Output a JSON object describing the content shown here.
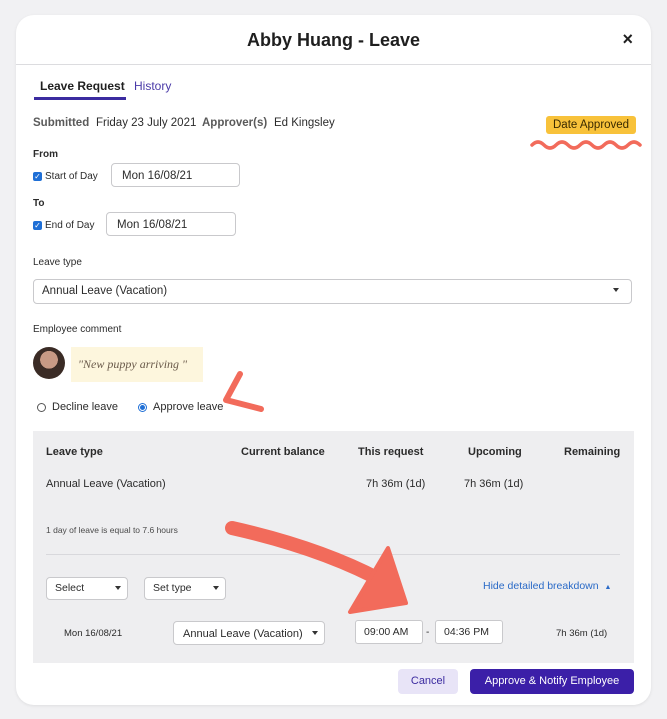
{
  "modal": {
    "title": "Abby Huang - Leave",
    "close_icon": "×"
  },
  "tabs": [
    {
      "label": "Leave Request",
      "active": true
    },
    {
      "label": "History",
      "active": false
    }
  ],
  "meta": {
    "submitted_label": "Submitted",
    "submitted_value": "Friday 23 July 2021",
    "approvers_label": "Approver(s)",
    "approvers_value": "Ed Kingsley",
    "status": "Date Approved",
    "status_color": "#f8c23a"
  },
  "from": {
    "label": "From",
    "checkbox_label": "Start of Day",
    "checked": true,
    "date": "Mon 16/08/21"
  },
  "to": {
    "label": "To",
    "checkbox_label": "End of Day",
    "checked": true,
    "date": "Mon 16/08/21"
  },
  "leave_type": {
    "label": "Leave type",
    "value": "Annual Leave (Vacation)"
  },
  "comment": {
    "label": "Employee comment",
    "text": "\"New puppy arriving \""
  },
  "decision": {
    "decline_label": "Decline leave",
    "approve_label": "Approve leave",
    "selected": "approve"
  },
  "breakdown": {
    "headers": [
      "Leave type",
      "Current balance",
      "This request",
      "Upcoming",
      "Remaining"
    ],
    "row": {
      "type": "Annual Leave (Vacation)",
      "current_balance": "",
      "this_request": "7h 36m (1d)",
      "upcoming": "7h 36m (1d)",
      "remaining": ""
    },
    "note": "1 day of leave is equal to 7.6 hours",
    "select_label": "Select",
    "set_type_label": "Set type",
    "hide_link": "Hide detailed breakdown",
    "detail": {
      "date": "Mon 16/08/21",
      "type": "Annual Leave (Vacation)",
      "start_time": "09:00 AM",
      "end_time": "04:36 PM",
      "separator": "-",
      "total": "7h 36m (1d)"
    }
  },
  "footer": {
    "cancel_label": "Cancel",
    "approve_label": "Approve & Notify Employee"
  },
  "colors": {
    "accent": "#3b1fa8",
    "annotation": "#f26b5b",
    "link": "#2a6ac7"
  }
}
